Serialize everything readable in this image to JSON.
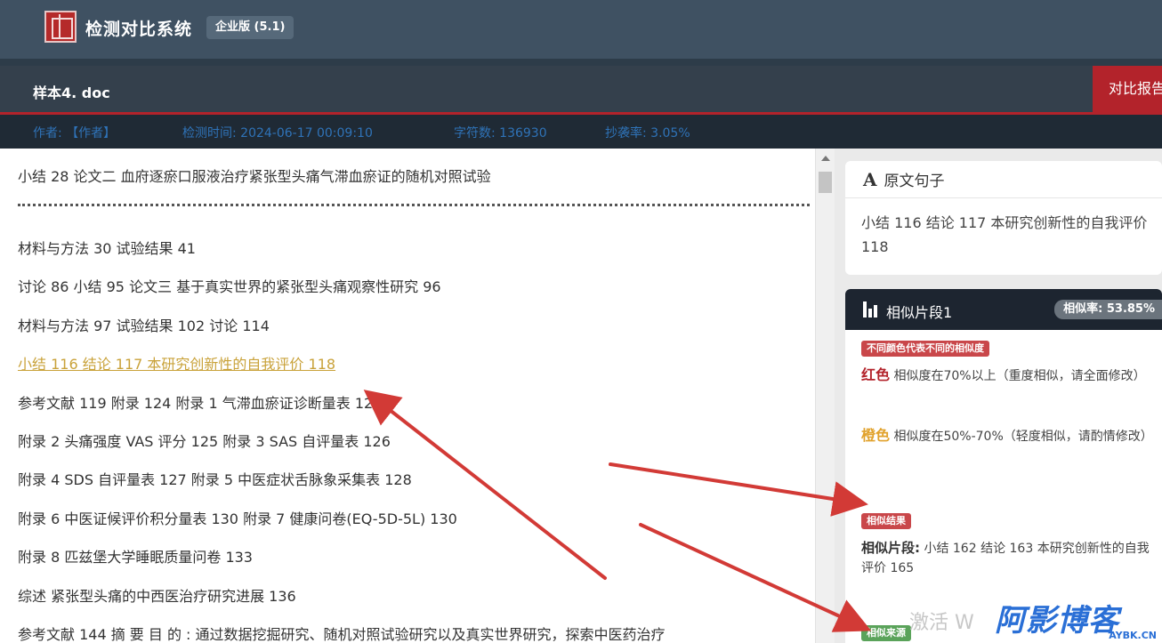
{
  "app": {
    "title": "检测对比系统",
    "edition": "企业版 (5.1)"
  },
  "file": {
    "name": "样本4. doc",
    "report_tab": "对比报告"
  },
  "meta": {
    "author": "作者: 【作者】",
    "detect_time": "检测时间: 2024-06-17 00:09:10",
    "char_count": "字符数: 136930",
    "copy_rate": "抄袭率: 3.05%"
  },
  "document": {
    "lines": [
      "小结 28 论文二 血府逐瘀口服液治疗紧张型头痛气滞血瘀证的随机对照试验",
      "材料与方法 30 试验结果 41",
      "讨论 86 小结 95 论文三 基于真实世界的紧张型头痛观察性研究 96",
      "材料与方法 97 试验结果 102 讨论 114",
      "小结 116 结论 117 本研究创新性的自我评价 118",
      "参考文献 119 附录 124 附录 1 气滞血瘀证诊断量表 124",
      "附录 2 头痛强度 VAS 评分 125 附录 3 SAS 自评量表 126",
      "附录 4 SDS 自评量表 127 附录 5 中医症状舌脉象采集表 128",
      "附录 6 中医证候评价积分量表 130 附录 7 健康问卷(EQ-5D-5L) 130",
      "附录 8 匹兹堡大学睡眠质量问卷 133",
      "综述 紧张型头痛的中西医治疗研究进展 136",
      "参考文献 144 摘 要 目 的 : 通过数据挖掘研究、随机对照试验研究以及真实世界研究，探索中医药治疗"
    ],
    "highlighted_line": 4
  },
  "original_sentence": {
    "icon_letter": "A",
    "title": "原文句子",
    "text": "小结 116 结论 117 本研究创新性的自我评价 118"
  },
  "similar_fragment": {
    "title": "相似片段1",
    "rate": "相似率: 53.85%",
    "legend_tag": "不同颜色代表不同的相似度",
    "red_word": "红色",
    "red_desc": "相似度在70%以上（重度相似，请全面修改）",
    "orange_word": "橙色",
    "orange_desc": "相似度在50%-70%（轻度相似，请酌情修改）",
    "result_tag": "相似结果",
    "fragment_label": "相似片段:",
    "fragment_text": "小结 162 结论 163 本研究创新性的自我评价 165",
    "source_tag": "相似来源"
  },
  "watermark": {
    "activate": "激活 W",
    "brand": "阿影博客",
    "brand_url": "AYBK.CN"
  },
  "colors": {
    "accent_red": "#b3232b",
    "orange": "#e1a22c",
    "brand_blue": "#2a6fd6",
    "arrow": "#d23a36"
  }
}
